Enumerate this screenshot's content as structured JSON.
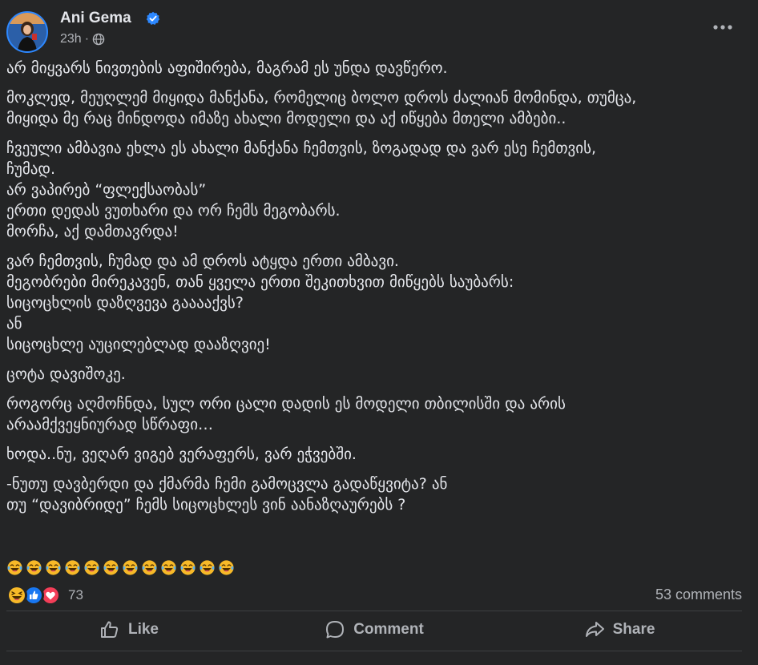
{
  "post": {
    "author": "Ani Gema",
    "timestamp": "23h",
    "privacy_icon": "globe-icon",
    "verified_icon": "verified-badge-icon",
    "more_icon": "more-horizontal-icon",
    "paragraphs": [
      [
        "არ მიყვარს ნივთების აფიშირება, მაგრამ ეს უნდა დავწერო."
      ],
      [
        "მოკლედ, მეუღლემ მიყიდა მანქანა, რომელიც ბოლო დროს ძალიან მომინდა, თუმცა,",
        "მიყიდა მე რაც მინდოდა იმაზე ახალი მოდელი და აქ იწყება მთელი ამბები.."
      ],
      [
        "ჩვეული ამბავია ეხლა ეს ახალი მანქანა ჩემთვის, ზოგადად და ვარ ესე ჩემთვის,",
        "ჩუმად.",
        "არ ვაპირებ “ფლექსაობას”",
        "ერთი დედას ვუთხარი და ორ ჩემს მეგობარს.",
        "მორჩა, აქ დამთავრდა!"
      ],
      [
        "ვარ ჩემთვის, ჩუმად და ამ დროს ატყდა ერთი ამბავი.",
        "მეგობრები მირეკავენ, თან ყველა ერთი შეკითხვით მიწყებს საუბარს:",
        "სიცოცხლის დაზღვევა გააააქვს?",
        "ან",
        "სიცოცხლე აუცილებლად დააზღვიე!"
      ],
      [
        "ცოტა დავიშოკე."
      ],
      [
        "როგორც აღმოჩნდა, სულ ორი ცალი დადის ეს მოდელი თბილისში და არის",
        "არაამქვეყნიურად სწრაფი…"
      ],
      [
        "ხოდა..ნუ, ვეღარ ვიგებ ვერაფერს, ვარ ეჭვებში."
      ],
      [
        "-ნუთუ დავბერდი და ქმარმა ჩემი გამოცვლა გადაწყვიტა? ან",
        "თუ “დავიბრიდე” ჩემს სიცოცხლეს ვინ აანაზღაურებს ?"
      ]
    ],
    "emoji_row": [
      "😂",
      "😂",
      "😂",
      "😂",
      "😂",
      "😂",
      "😂",
      "😂",
      "😂",
      "😂",
      "😂",
      "😂"
    ],
    "emoji_icon": "tears-of-joy-emoji-icon"
  },
  "stats": {
    "reaction_icons": [
      "haha-reaction-icon",
      "like-reaction-icon",
      "love-reaction-icon"
    ],
    "reaction_count": "73",
    "comments": "53 comments"
  },
  "actions": {
    "like": "Like",
    "comment": "Comment",
    "share": "Share"
  },
  "colors": {
    "background": "#242526",
    "text_primary": "#e4e6eb",
    "text_secondary": "#b0b3b8",
    "verified": "#2d88ff",
    "like_blue": "#1877f2",
    "love_red": "#f33e58",
    "haha_yellow": "#f7b928"
  }
}
